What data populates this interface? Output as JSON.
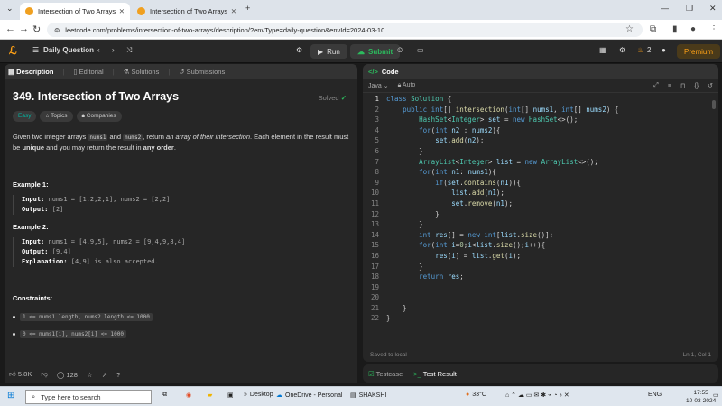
{
  "browser": {
    "tabs": [
      {
        "title": "Intersection of Two Arrays - Lee",
        "active": true
      },
      {
        "title": "Intersection of Two Arrays - Lee",
        "active": false
      }
    ],
    "url": "leetcode.com/problems/intersection-of-two-arrays/description/?envType=daily-question&envId=2024-03-10"
  },
  "topbar": {
    "section_label": "Daily Question",
    "run_label": "Run",
    "submit_label": "Submit",
    "streak_count": "2",
    "premium_label": "Premium"
  },
  "left_tabs": [
    "Description",
    "Editorial",
    "Solutions",
    "Submissions"
  ],
  "problem": {
    "title": "349. Intersection of Two Arrays",
    "status": "Solved",
    "difficulty": "Easy",
    "chips": [
      "Topics",
      "Companies"
    ],
    "desc_a": "Given two integer arrays ",
    "code_a": "nums1",
    "desc_b": " and ",
    "code_b": "nums2",
    "desc_c": ", return ",
    "desc_em": "an array of their intersection",
    "desc_d": ". Each element in the result must be ",
    "desc_unique": "unique",
    "desc_e": " and you may return the result in ",
    "desc_anyorder": "any order",
    "desc_f": ".",
    "examples": [
      {
        "title": "Example 1:",
        "input_label": "Input:",
        "input": "nums1 = [1,2,2,1], nums2 = [2,2]",
        "output_label": "Output:",
        "output": "[2]"
      },
      {
        "title": "Example 2:",
        "input_label": "Input:",
        "input": "nums1 = [4,9,5], nums2 = [9,4,9,8,4]",
        "output_label": "Output:",
        "output": "[9,4]",
        "explanation_label": "Explanation:",
        "explanation": "[4,9] is also accepted."
      }
    ],
    "constraints_title": "Constraints:",
    "constraints": [
      "1 <= nums1.length, nums2.length <= 1000",
      "0 <= nums1[i], nums2[i] <= 1000"
    ]
  },
  "footer": {
    "likes": "5.8K",
    "comments": "128"
  },
  "editor": {
    "title": "Code",
    "language": "Java",
    "mode": "Auto",
    "saved": "Saved to local",
    "cursor": "Ln 1, Col 1"
  },
  "bottom_tabs": [
    "Testcase",
    "Test Result"
  ],
  "taskbar": {
    "search_placeholder": "Type here to search",
    "desktop": "Desktop",
    "onedrive": "OneDrive - Personal",
    "user": "SHAKSHI",
    "temp": "33°C",
    "lang": "ENG",
    "time": "17:55",
    "date": "10-03-2024"
  }
}
